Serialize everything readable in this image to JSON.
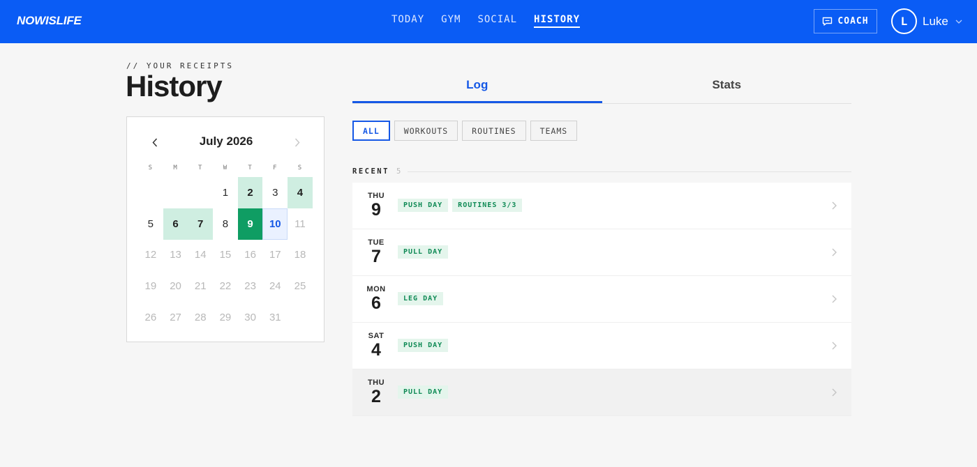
{
  "header": {
    "logo": "NOWISLIFE",
    "nav": [
      {
        "label": "TODAY",
        "active": false
      },
      {
        "label": "GYM",
        "active": false
      },
      {
        "label": "SOCIAL",
        "active": false
      },
      {
        "label": "HISTORY",
        "active": true
      }
    ],
    "coach_label": "COACH",
    "coach_icon": "message-square-icon",
    "user": {
      "initial": "L",
      "name": "Luke",
      "caret_icon": "chevron-down-icon"
    }
  },
  "page": {
    "eyebrow": "// YOUR RECEIPTS",
    "title": "History"
  },
  "calendar": {
    "month_label": "July 2026",
    "prev_icon": "chevron-left-icon",
    "next_icon": "chevron-right-icon",
    "weekdays": [
      "S",
      "M",
      "T",
      "W",
      "T",
      "F",
      "S"
    ],
    "weeks": [
      [
        {
          "d": ""
        },
        {
          "d": ""
        },
        {
          "d": ""
        },
        {
          "d": "1"
        },
        {
          "d": "2",
          "state": "logged"
        },
        {
          "d": "3"
        },
        {
          "d": "4",
          "state": "logged"
        }
      ],
      [
        {
          "d": "5"
        },
        {
          "d": "6",
          "state": "logged"
        },
        {
          "d": "7",
          "state": "logged"
        },
        {
          "d": "8"
        },
        {
          "d": "9",
          "state": "selected"
        },
        {
          "d": "10",
          "state": "today"
        },
        {
          "d": "11",
          "state": "future"
        }
      ],
      [
        {
          "d": "12",
          "state": "future"
        },
        {
          "d": "13",
          "state": "future"
        },
        {
          "d": "14",
          "state": "future"
        },
        {
          "d": "15",
          "state": "future"
        },
        {
          "d": "16",
          "state": "future"
        },
        {
          "d": "17",
          "state": "future"
        },
        {
          "d": "18",
          "state": "future"
        }
      ],
      [
        {
          "d": "19",
          "state": "future"
        },
        {
          "d": "20",
          "state": "future"
        },
        {
          "d": "21",
          "state": "future"
        },
        {
          "d": "22",
          "state": "future"
        },
        {
          "d": "23",
          "state": "future"
        },
        {
          "d": "24",
          "state": "future"
        },
        {
          "d": "25",
          "state": "future"
        }
      ],
      [
        {
          "d": "26",
          "state": "future"
        },
        {
          "d": "27",
          "state": "future"
        },
        {
          "d": "28",
          "state": "future"
        },
        {
          "d": "29",
          "state": "future"
        },
        {
          "d": "30",
          "state": "future"
        },
        {
          "d": "31",
          "state": "future"
        },
        {
          "d": ""
        }
      ]
    ]
  },
  "tabs": [
    {
      "label": "Log",
      "active": true
    },
    {
      "label": "Stats",
      "active": false
    }
  ],
  "filters": [
    {
      "label": "ALL",
      "active": true
    },
    {
      "label": "WORKOUTS",
      "active": false
    },
    {
      "label": "ROUTINES",
      "active": false
    },
    {
      "label": "TEAMS",
      "active": false
    }
  ],
  "recent": {
    "label": "RECENT",
    "count": "5"
  },
  "log": [
    {
      "dow": "THU",
      "day": "9",
      "tags": [
        "PUSH DAY",
        "ROUTINES 3/3"
      ],
      "dim": false
    },
    {
      "dow": "TUE",
      "day": "7",
      "tags": [
        "PULL DAY"
      ],
      "dim": false
    },
    {
      "dow": "MON",
      "day": "6",
      "tags": [
        "LEG DAY"
      ],
      "dim": false
    },
    {
      "dow": "SAT",
      "day": "4",
      "tags": [
        "PUSH DAY"
      ],
      "dim": false
    },
    {
      "dow": "THU",
      "day": "2",
      "tags": [
        "PULL DAY"
      ],
      "dim": true
    }
  ],
  "colors": {
    "brand": "#0a5cf5",
    "accent": "#1558e6",
    "logged": "#cfeee1",
    "selected": "#0f9d63",
    "tag_bg": "#e4f5ec",
    "tag_text": "#0f8a55"
  }
}
